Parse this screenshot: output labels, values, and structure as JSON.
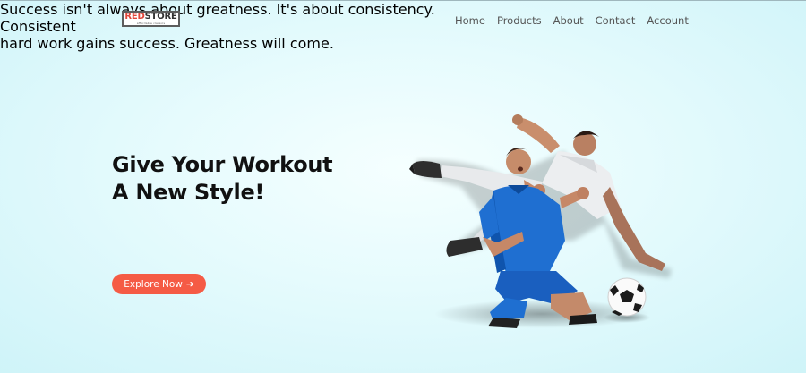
{
  "header": {
    "logo": {
      "red": "RED",
      "dark": "STORE",
      "tagline": "affordable classics"
    },
    "nav": [
      "Home",
      "Products",
      "About",
      "Contact",
      "Account"
    ]
  },
  "hero": {
    "title_line1": "Give Your Workout",
    "title_line2": "A New Style!",
    "desc_line1": "Success isn't always about greatness. It's about consistency.",
    "desc_line2": "Consistent",
    "desc_line3": "hard work gains success. Greatness will come.",
    "cta_label": "Explore Now",
    "cta_arrow": "➔"
  },
  "colors": {
    "accent": "#f55b45",
    "logo_red": "#e2463a",
    "jersey_blue": "#1f6fd1",
    "background": "#e6fbfd"
  },
  "icons": {
    "cta": "arrow-right-icon",
    "image": "soccer-players-illustration"
  }
}
